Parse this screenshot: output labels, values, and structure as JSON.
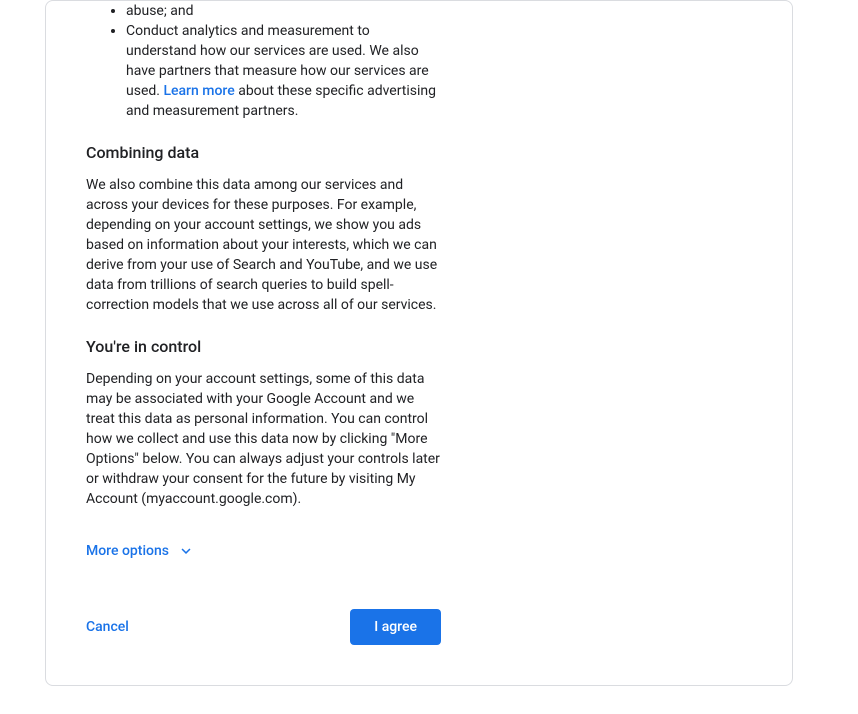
{
  "bullets": {
    "item1_tail": "abuse; and",
    "item2_before": "Conduct analytics and measurement to understand how our services are used. We also have partners that measure how our services are used. ",
    "item2_link": "Learn more",
    "item2_after": " about these specific advertising and measurement partners."
  },
  "section1": {
    "heading": "Combining data",
    "body": "We also combine this data among our services and across your devices for these purposes. For example, depending on your account settings, we show you ads based on information about your interests, which we can derive from your use of Search and YouTube, and we use data from trillions of search queries to build spell-correction models that we use across all of our services."
  },
  "section2": {
    "heading": "You're in control",
    "body": "Depending on your account settings, some of this data may be associated with your Google Account and we treat this data as personal information. You can control how we collect and use this data now by clicking \"More Options\" below. You can always adjust your controls later or withdraw your consent for the future by visiting My Account (myaccount.google.com)."
  },
  "more_options": "More options",
  "actions": {
    "cancel": "Cancel",
    "agree": "I agree"
  }
}
